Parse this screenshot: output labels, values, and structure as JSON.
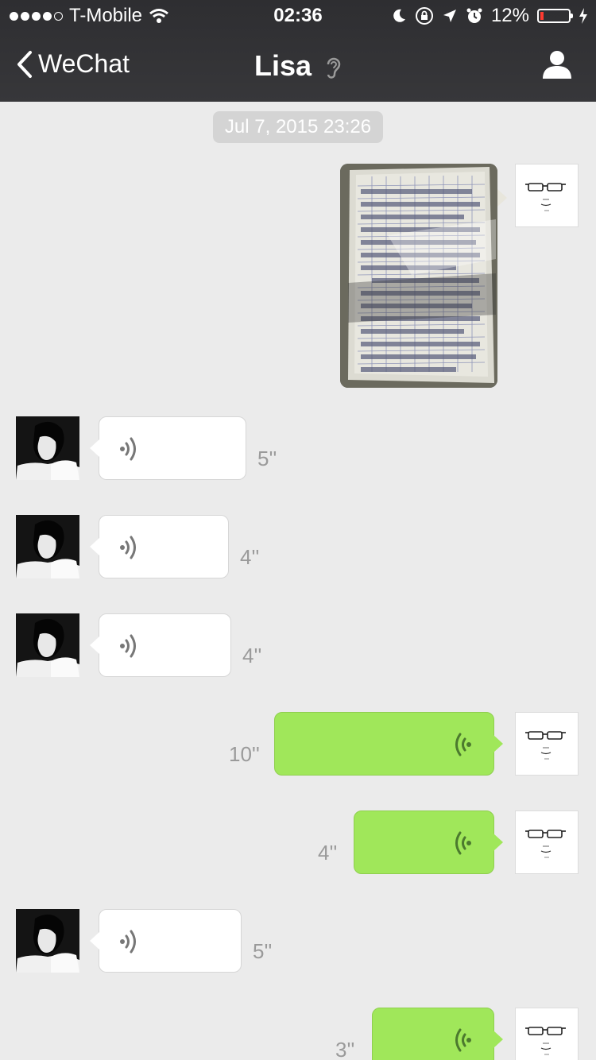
{
  "status_bar": {
    "carrier": "T-Mobile",
    "time": "02:36",
    "battery": "12%",
    "battery_level": 0.12,
    "battery_color": "#ff3b30"
  },
  "nav": {
    "back_label": "WeChat",
    "title": "Lisa"
  },
  "chat": {
    "timestamp": "Jul 7, 2015 23:26",
    "messages": [
      {
        "from": "me",
        "kind": "image"
      },
      {
        "from": "Lisa",
        "kind": "voice",
        "duration": "5''"
      },
      {
        "from": "Lisa",
        "kind": "voice",
        "duration": "4''"
      },
      {
        "from": "Lisa",
        "kind": "voice",
        "duration": "4''"
      },
      {
        "from": "me",
        "kind": "voice",
        "duration": "10''"
      },
      {
        "from": "me",
        "kind": "voice",
        "duration": "4''"
      },
      {
        "from": "Lisa",
        "kind": "voice",
        "duration": "5''"
      },
      {
        "from": "me",
        "kind": "voice",
        "duration": "3''"
      }
    ]
  },
  "colors": {
    "nav_background": "#2e2e31",
    "chat_background": "#ebebeb",
    "outgoing_bubble": "#a0e75a",
    "incoming_bubble": "#ffffff"
  }
}
